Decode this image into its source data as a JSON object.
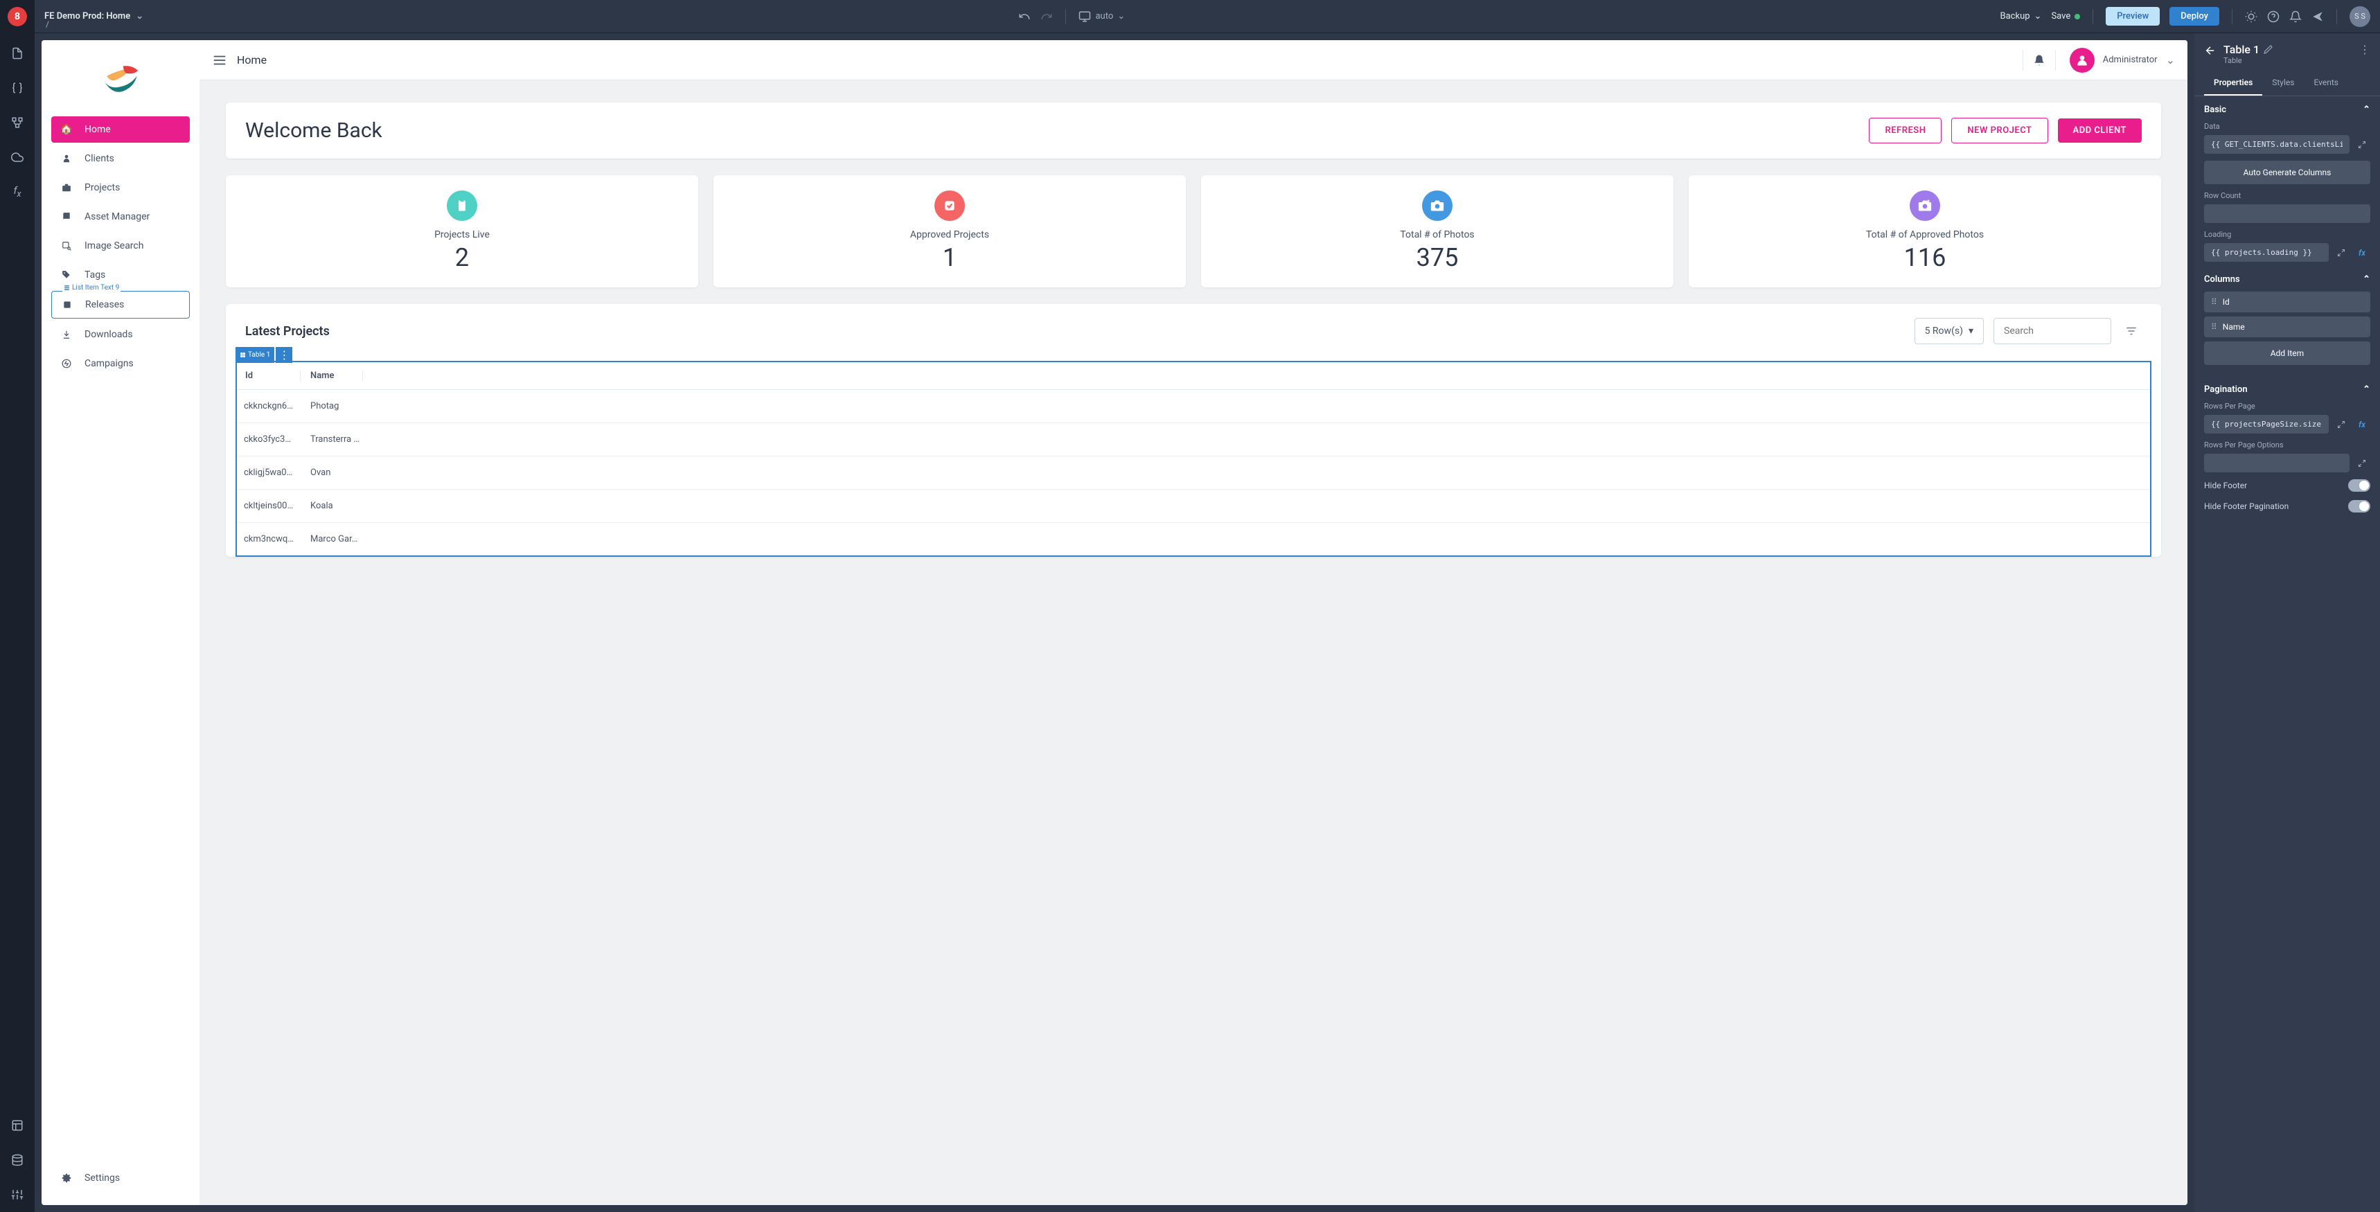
{
  "topbar": {
    "title": "FE Demo Prod: Home",
    "path": "/",
    "viewport": "auto",
    "backup": "Backup",
    "save": "Save",
    "preview": "Preview",
    "deploy": "Deploy",
    "avatar": "S S"
  },
  "app": {
    "header_title": "Home",
    "user_name": "Administrator",
    "welcome": {
      "title": "Welcome Back",
      "refresh": "REFRESH",
      "new_project": "NEW PROJECT",
      "add_client": "ADD CLIENT"
    },
    "sidebar": {
      "items": [
        {
          "label": "Home",
          "icon": "home",
          "active": true
        },
        {
          "label": "Clients",
          "icon": "person"
        },
        {
          "label": "Projects",
          "icon": "briefcase"
        },
        {
          "label": "Asset Manager",
          "icon": "book"
        },
        {
          "label": "Image Search",
          "icon": "image-search"
        },
        {
          "label": "Tags",
          "icon": "tag"
        },
        {
          "label": "Releases",
          "icon": "release"
        },
        {
          "label": "Downloads",
          "icon": "download"
        },
        {
          "label": "Campaigns",
          "icon": "campaign"
        }
      ],
      "settings": "Settings",
      "list_item_label": "List Item Text 9"
    },
    "stats": [
      {
        "label": "Projects Live",
        "value": "2",
        "icon": "clipboard",
        "color": "teal"
      },
      {
        "label": "Approved Projects",
        "value": "1",
        "icon": "check",
        "color": "red"
      },
      {
        "label": "Total # of Photos",
        "value": "375",
        "icon": "camera",
        "color": "blue"
      },
      {
        "label": "Total # of Approved Photos",
        "value": "116",
        "icon": "camera-plus",
        "color": "purple"
      }
    ],
    "projects": {
      "title": "Latest Projects",
      "rows_label": "5 Row(s)",
      "search_placeholder": "Search",
      "table_tag": "Table 1",
      "columns": [
        "Id",
        "Name"
      ],
      "rows": [
        {
          "id": "ckknckgn6…",
          "name": "Photag"
        },
        {
          "id": "ckko3fyc3…",
          "name": "Transterra …"
        },
        {
          "id": "ckligj5wa0…",
          "name": "Ovan"
        },
        {
          "id": "ckltjeins00…",
          "name": "Koala"
        },
        {
          "id": "ckm3ncwq…",
          "name": "Marco Gar…"
        }
      ]
    }
  },
  "props": {
    "title": "Table 1",
    "subtitle": "Table",
    "tabs": [
      "Properties",
      "Styles",
      "Events"
    ],
    "active_tab": 0,
    "sections": {
      "basic": {
        "title": "Basic",
        "data_label": "Data",
        "data_value": "{{ GET_CLIENTS.data.clientsList.items }}",
        "autogen": "Auto Generate Columns",
        "row_count_label": "Row Count",
        "row_count_value": "",
        "loading_label": "Loading",
        "loading_value": "{{ projects.loading }}"
      },
      "columns": {
        "title": "Columns",
        "items": [
          "Id",
          "Name"
        ],
        "add_item": "Add Item"
      },
      "pagination": {
        "title": "Pagination",
        "rows_per_page_label": "Rows Per Page",
        "rows_per_page_value": "{{ projectsPageSize.size }}",
        "rows_per_page_options_label": "Rows Per Page Options",
        "rows_per_page_options_value": "",
        "hide_footer": "Hide Footer",
        "hide_footer_pagination": "Hide Footer Pagination"
      }
    }
  }
}
